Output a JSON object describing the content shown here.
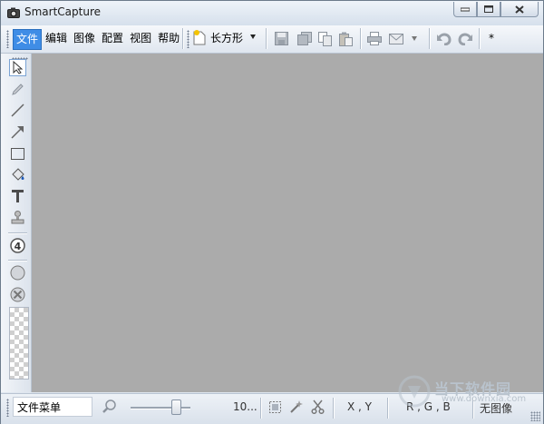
{
  "window": {
    "title": "SmartCapture"
  },
  "menu": {
    "items": [
      "文件",
      "编辑",
      "图像",
      "配置",
      "视图",
      "帮助"
    ]
  },
  "toolbar": {
    "shape_label": "长方形",
    "modified_marker": "*"
  },
  "status": {
    "menu_hint": "文件菜单",
    "zoom": "10...",
    "coords": "X , Y",
    "rgb": "R , G , B",
    "image_info": "无图像"
  },
  "watermark": {
    "site": "当下软件园",
    "url": "www.downxia.com"
  },
  "colors": {
    "canvas": "#ababab",
    "menu_active": "#3f8de6"
  }
}
